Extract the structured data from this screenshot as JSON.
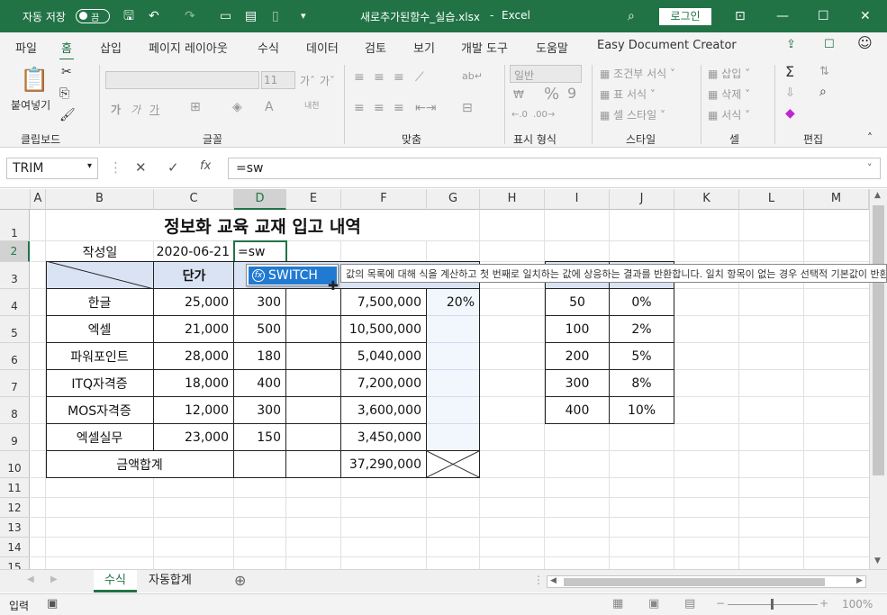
{
  "titlebar": {
    "autosave_label": "자동 저장",
    "autosave_state": "끔",
    "filename": "새로추가된함수_실습.xlsx",
    "sep": "-",
    "app": "Excel",
    "login": "로그인"
  },
  "tabs": [
    "파일",
    "홈",
    "삽입",
    "페이지 레이아웃",
    "수식",
    "데이터",
    "검토",
    "보기",
    "개발 도구",
    "도움말",
    "Easy Document Creator"
  ],
  "ribbon": {
    "clipboard": {
      "paste": "붙여넣기",
      "group": "클립보드"
    },
    "font": {
      "font_size": "11",
      "group": "글꼴",
      "bold": "가",
      "italic": "가",
      "underline": "가"
    },
    "alignment": {
      "group": "맞춤"
    },
    "number": {
      "format": "일반",
      "group": "표시 형식",
      "percent": "%",
      "comma": "9"
    },
    "styles": {
      "cond": "조건부 서식",
      "table": "표 서식",
      "cell": "셀 스타일",
      "group": "스타일"
    },
    "cells": {
      "insert": "삽입",
      "delete": "삭제",
      "format": "서식",
      "group": "셀"
    },
    "editing": {
      "group": "편집"
    }
  },
  "formula_bar": {
    "name_box": "TRIM",
    "formula": "=sw",
    "fx": "fx"
  },
  "columns": [
    "A",
    "B",
    "C",
    "D",
    "E",
    "F",
    "G",
    "H",
    "I",
    "J",
    "K",
    "L",
    "M"
  ],
  "rows": [
    "1",
    "2",
    "3",
    "4",
    "5",
    "6",
    "7",
    "8",
    "9",
    "10",
    "11",
    "12",
    "13",
    "14",
    "15"
  ],
  "sheet": {
    "title": "정보화 교육 교재 입고 내역",
    "date_label": "작성일",
    "date_value": "2020-06-21",
    "edit_value": "=sw",
    "header_price": "단가",
    "items": [
      {
        "name": "한글",
        "price": "25,000",
        "qty": "300",
        "amount": "7,500,000",
        "rate": "20%"
      },
      {
        "name": "엑셀",
        "price": "21,000",
        "qty": "500",
        "amount": "10,500,000",
        "rate": ""
      },
      {
        "name": "파워포인트",
        "price": "28,000",
        "qty": "180",
        "amount": "5,040,000",
        "rate": ""
      },
      {
        "name": "ITQ자격증",
        "price": "18,000",
        "qty": "400",
        "amount": "7,200,000",
        "rate": ""
      },
      {
        "name": "MOS자격증",
        "price": "12,000",
        "qty": "300",
        "amount": "3,600,000",
        "rate": ""
      },
      {
        "name": "엑셀실무",
        "price": "23,000",
        "qty": "150",
        "amount": "3,450,000",
        "rate": ""
      }
    ],
    "total_label": "금액합계",
    "total_value": "37,290,000",
    "lookup": [
      {
        "k": "50",
        "v": "0%"
      },
      {
        "k": "100",
        "v": "2%"
      },
      {
        "k": "200",
        "v": "5%"
      },
      {
        "k": "300",
        "v": "8%"
      },
      {
        "k": "400",
        "v": "10%"
      }
    ]
  },
  "autocomplete": {
    "item": "SWITCH",
    "tooltip": "값의 목록에 대해 식을 계산하고 첫 번째로 일치하는 값에 상응하는 결과를 반환합니다. 일치 항목이 없는 경우 선택적 기본값이 반환됩니다."
  },
  "sheet_tabs": [
    "수식",
    "자동합계"
  ],
  "status": {
    "mode": "입력",
    "zoom": "100%"
  }
}
